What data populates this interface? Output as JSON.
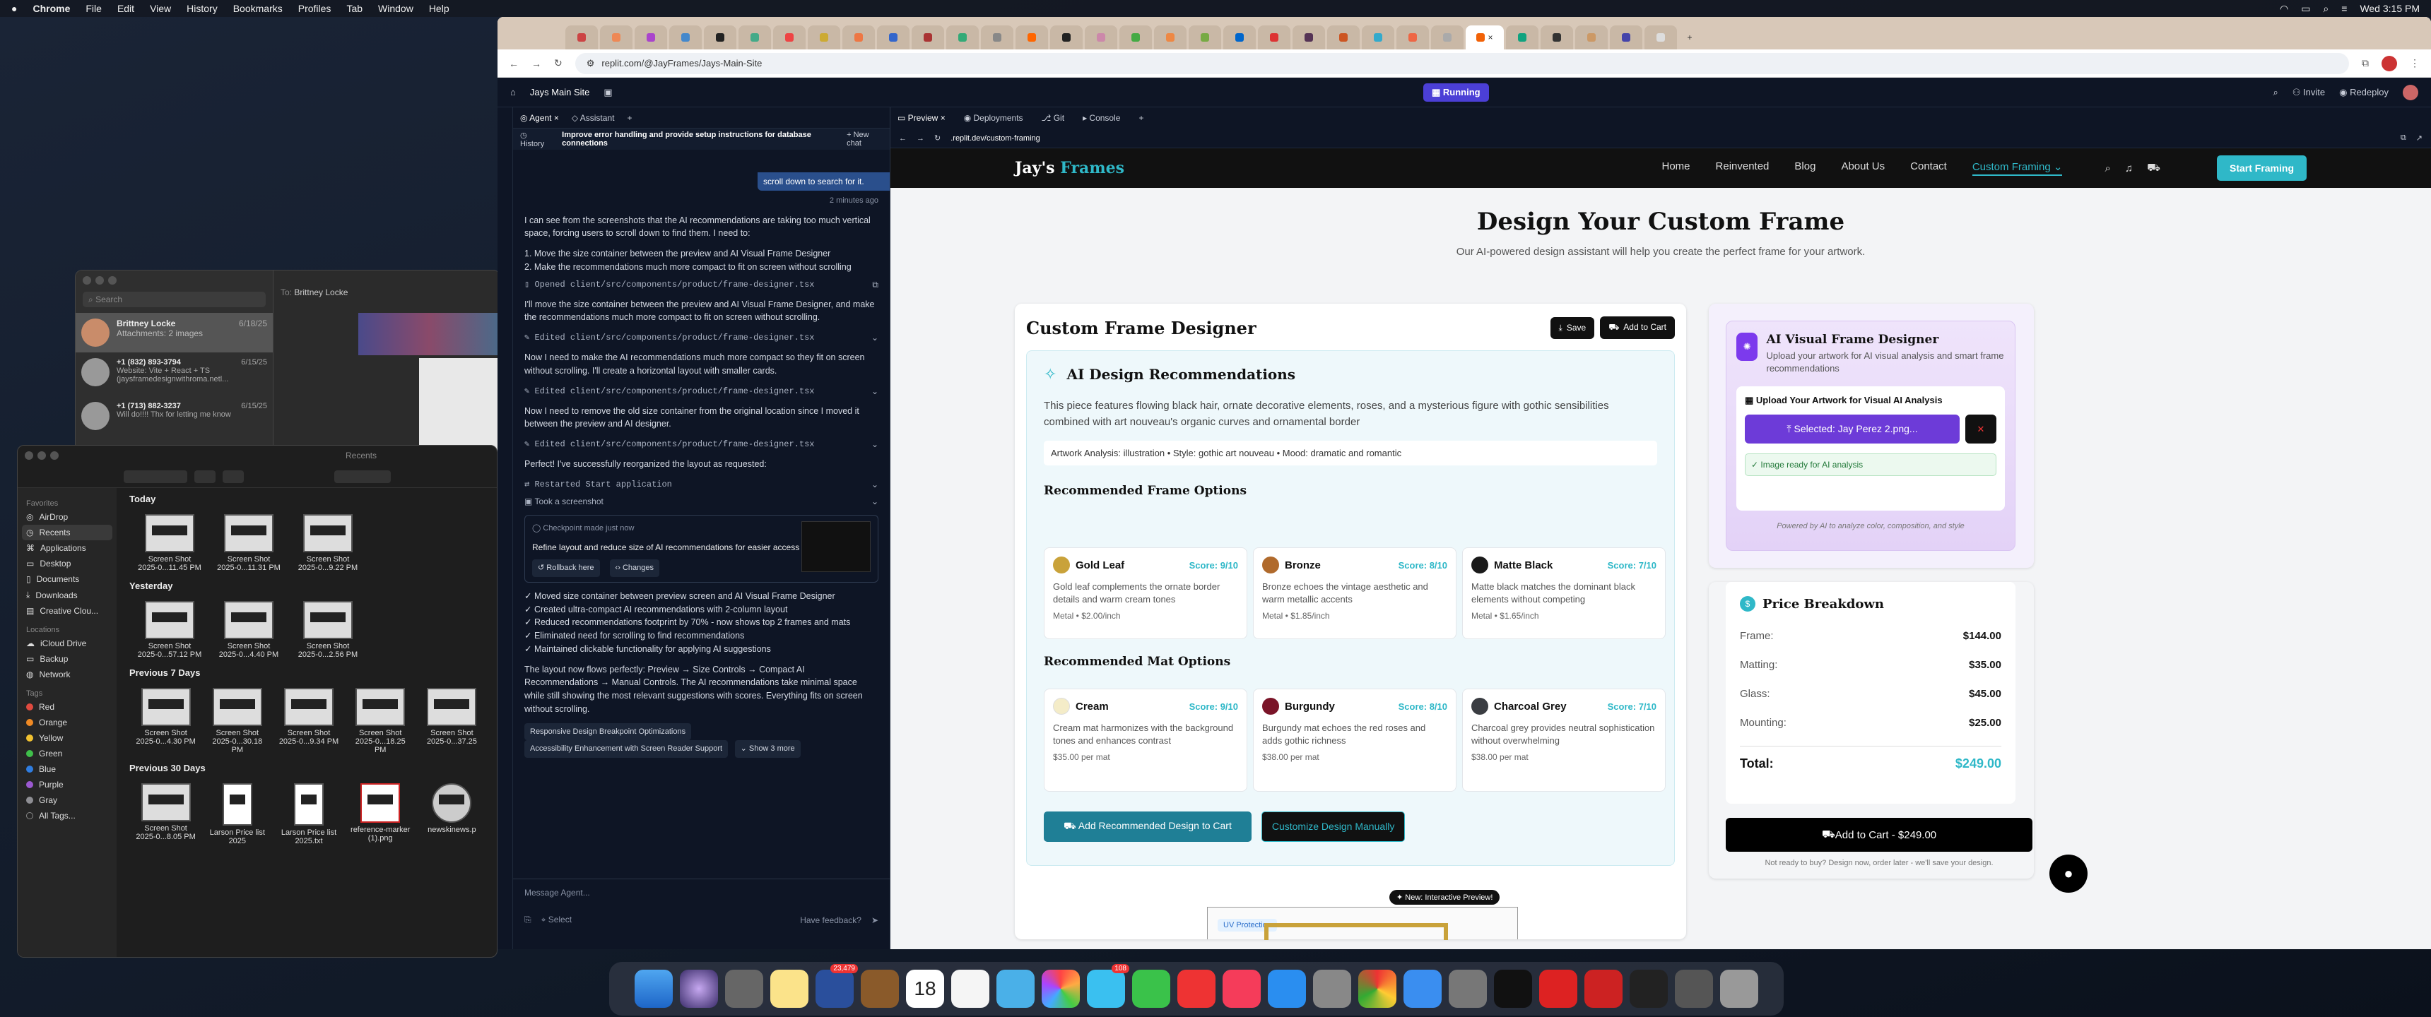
{
  "menubar": {
    "app": "Chrome",
    "items": [
      "File",
      "Edit",
      "View",
      "History",
      "Bookmarks",
      "Profiles",
      "Tab",
      "Window",
      "Help"
    ],
    "clock": "Wed 3:15 PM"
  },
  "messages": {
    "search": "Search",
    "to_label": "To:",
    "to_name": "Brittney Locke",
    "threads": [
      {
        "name": "Brittney Locke",
        "date": "6/18/25",
        "preview": "Attachments: 2 images"
      },
      {
        "name": "+1 (832) 893-3794",
        "date": "6/15/25",
        "preview": "Website: Vite + React + TS (jaysframedesignwithroma.netl..."
      },
      {
        "name": "+1 (713) 882-3237",
        "date": "6/15/25",
        "preview": "Will do!!!! Thx for letting me know"
      }
    ]
  },
  "finder": {
    "title": "Recents",
    "favorites_header": "Favorites",
    "favorites": [
      "AirDrop",
      "Recents",
      "Applications",
      "Desktop",
      "Documents",
      "Downloads",
      "Creative Clou..."
    ],
    "locations_header": "Locations",
    "locations": [
      "iCloud Drive",
      "Backup",
      "Network"
    ],
    "tags_header": "Tags",
    "tags": [
      {
        "name": "Red",
        "color": "#e04a3f"
      },
      {
        "name": "Orange",
        "color": "#f08a24"
      },
      {
        "name": "Yellow",
        "color": "#f2c230"
      },
      {
        "name": "Green",
        "color": "#3fbf4a"
      },
      {
        "name": "Blue",
        "color": "#2f7de0"
      },
      {
        "name": "Purple",
        "color": "#9b59d0"
      },
      {
        "name": "Gray",
        "color": "#8e8e93"
      },
      {
        "name": "All Tags...",
        "color": ""
      }
    ],
    "sections": [
      {
        "title": "Today",
        "items": [
          {
            "name": "Screen Shot",
            "date": "2025-0...11.45 PM"
          },
          {
            "name": "Screen Shot",
            "date": "2025-0...11.31 PM"
          },
          {
            "name": "Screen Shot",
            "date": "2025-0...9.22 PM"
          }
        ]
      },
      {
        "title": "Yesterday",
        "items": [
          {
            "name": "Screen Shot",
            "date": "2025-0...57.12 PM"
          },
          {
            "name": "Screen Shot",
            "date": "2025-0...4.40 PM"
          },
          {
            "name": "Screen Shot",
            "date": "2025-0...2.56 PM"
          }
        ]
      },
      {
        "title": "Previous 7 Days",
        "items": [
          {
            "name": "Screen Shot",
            "date": "2025-0...4.30 PM"
          },
          {
            "name": "Screen Shot",
            "date": "2025-0...30.18 PM"
          },
          {
            "name": "Screen Shot",
            "date": "2025-0...9.34 PM"
          },
          {
            "name": "Screen Shot",
            "date": "2025-0...18.25 PM"
          },
          {
            "name": "Screen Shot",
            "date": "2025-0...37.25"
          }
        ]
      },
      {
        "title": "Previous 30 Days",
        "items": [
          {
            "name": "Screen Shot",
            "date": "2025-0...8.05 PM"
          },
          {
            "name": "Larson Price list",
            "date": "2025"
          },
          {
            "name": "Larson Price list",
            "date": "2025.txt"
          },
          {
            "name": "reference-marker",
            "date": "(1).png"
          },
          {
            "name": "newskinews.p",
            "date": ""
          }
        ]
      }
    ]
  },
  "chrome": {
    "url": "replit.com/@JayFrames/Jays-Main-Site",
    "tab_count": 36
  },
  "replit": {
    "project": "Jays Main Site",
    "status": "Running",
    "invite": "Invite",
    "redeploy": "Redeploy",
    "tabs": [
      "Agent",
      "Assistant"
    ],
    "history": "History",
    "chat_title": "Improve error handling and provide setup instructions for database connections",
    "new_chat": "New chat",
    "bubble": "scroll down to search for it.",
    "time": "2 minutes ago",
    "msg1": "I can see from the screenshots that the AI recommendations are taking too much vertical space, forcing users to scroll down to find them. I need to:",
    "steps": [
      "1. Move the size container between the preview and AI Visual Frame Designer",
      "2. Make the recommendations much more compact to fit on screen without scrolling"
    ],
    "opened": "Opened client/src/components/product/frame-designer.tsx",
    "msg2": "I'll move the size container between the preview and AI Visual Frame Designer, and make the recommendations much more compact to fit on screen without scrolling.",
    "edited": "Edited client/src/components/product/frame-designer.tsx",
    "msg3": "Now I need to make the AI recommendations much more compact so they fit on screen without scrolling. I'll create a horizontal layout with smaller cards.",
    "msg4": "Now I need to remove the old size container from the original location since I moved it between the preview and AI designer.",
    "msg5": "Perfect! I've successfully reorganized the layout as requested:",
    "restarted": "Restarted Start application",
    "took_shot": "Took a screenshot",
    "checkpoint": "Checkpoint made just now",
    "checkpoint_title": "Refine layout and reduce size of AI recommendations for easier access",
    "rollback": "Rollback here",
    "changes": "Changes",
    "bullets": [
      "✓ Moved size container between preview screen and AI Visual Frame Designer",
      "✓ Created ultra-compact AI recommendations with 2-column layout",
      "✓ Reduced recommendations footprint by 70% - now shows top 2 frames and mats",
      "✓ Eliminated need for scrolling to find recommendations",
      "✓ Maintained clickable functionality for applying AI suggestions"
    ],
    "summary": "The layout now flows perfectly: Preview → Size Controls → Compact AI Recommendations → Manual Controls. The AI recommendations take minimal space while still showing the most relevant suggestions with scores. Everything fits on screen without scrolling.",
    "suggestions": [
      "Responsive Design Breakpoint Optimizations",
      "Accessibility Enhancement with Screen Reader Support",
      "Show 3 more"
    ],
    "composer": "Message Agent...",
    "select": "Select",
    "feedback": "Have feedback?",
    "preview_tabs": [
      "Preview",
      "Deployments",
      "Git",
      "Console"
    ],
    "preview_url": ".replit.dev/custom-framing"
  },
  "site": {
    "logo_a": "Jay's ",
    "logo_b": "Frames",
    "nav": [
      "Home",
      "Reinvented",
      "Blog",
      "About Us",
      "Contact",
      "Custom Framing"
    ],
    "cta": "Start Framing",
    "title": "Design Your Custom Frame",
    "subtitle": "Our AI-powered design assistant will help you create the perfect frame for your artwork.",
    "designer_title": "Custom Frame Designer",
    "save": "Save",
    "add_to_cart": "Add to Cart",
    "ai_title": "AI Design Recommendations",
    "ai_desc": "This piece features flowing black hair, ornate decorative elements, roses, and a mysterious figure with gothic sensibilities combined with art nouveau's organic curves and ornamental border",
    "analysis": "Artwork Analysis: illustration • Style: gothic art nouveau • Mood: dramatic and romantic",
    "frame_header": "Recommended Frame Options",
    "frames": [
      {
        "name": "Gold Leaf",
        "score": "Score: 9/10",
        "color": "#c9a23a",
        "desc": "Gold leaf complements the ornate border details and warm cream tones",
        "price": "Metal • $2.00/inch"
      },
      {
        "name": "Bronze",
        "score": "Score: 8/10",
        "color": "#b06a2c",
        "desc": "Bronze echoes the vintage aesthetic and warm metallic accents",
        "price": "Metal • $1.85/inch"
      },
      {
        "name": "Matte Black",
        "score": "Score: 7/10",
        "color": "#1a1a1a",
        "desc": "Matte black matches the dominant black elements without competing",
        "price": "Metal • $1.65/inch"
      }
    ],
    "mat_header": "Recommended Mat Options",
    "mats": [
      {
        "name": "Cream",
        "score": "Score: 9/10",
        "color": "#f4ecc8",
        "desc": "Cream mat harmonizes with the background tones and enhances contrast",
        "price": "$35.00 per mat"
      },
      {
        "name": "Burgundy",
        "score": "Score: 8/10",
        "color": "#7a1428",
        "desc": "Burgundy mat echoes the red roses and adds gothic richness",
        "price": "$38.00 per mat"
      },
      {
        "name": "Charcoal Grey",
        "score": "Score: 7/10",
        "color": "#3a3d42",
        "desc": "Charcoal grey provides neutral sophistication without overwhelming",
        "price": "$38.00 per mat"
      }
    ],
    "add_recommended": "Add Recommended Design to Cart",
    "customize": "Customize Design Manually",
    "badge": "New: Interactive Preview!",
    "uv": "UV Protection",
    "visual_title": "AI Visual Frame Designer",
    "visual_desc": "Upload your artwork for AI visual analysis and smart frame recommendations",
    "upload_title": "Upload Your Artwork for Visual AI Analysis",
    "selected": "Selected: Jay Perez 2.png...",
    "ready": "✓ Image ready for AI analysis",
    "powered": "Powered by AI to analyze color, composition, and style",
    "price_title": "Price Breakdown",
    "prices": [
      {
        "label": "Frame:",
        "value": "$144.00"
      },
      {
        "label": "Matting:",
        "value": "$35.00"
      },
      {
        "label": "Glass:",
        "value": "$45.00"
      },
      {
        "label": "Mounting:",
        "value": "$25.00"
      }
    ],
    "total_label": "Total:",
    "total_value": "$249.00",
    "cart_btn": "Add to Cart - $249.00",
    "later": "Not ready to buy? Design now, order later - we'll save your design."
  },
  "dock": {
    "calendar_day": "18",
    "badge_a": "23,479",
    "badge_b": "108"
  },
  "colors": {
    "accent": "#2fb8c8",
    "replit_bg": "#0e1525",
    "run": "#4b3fd6"
  }
}
